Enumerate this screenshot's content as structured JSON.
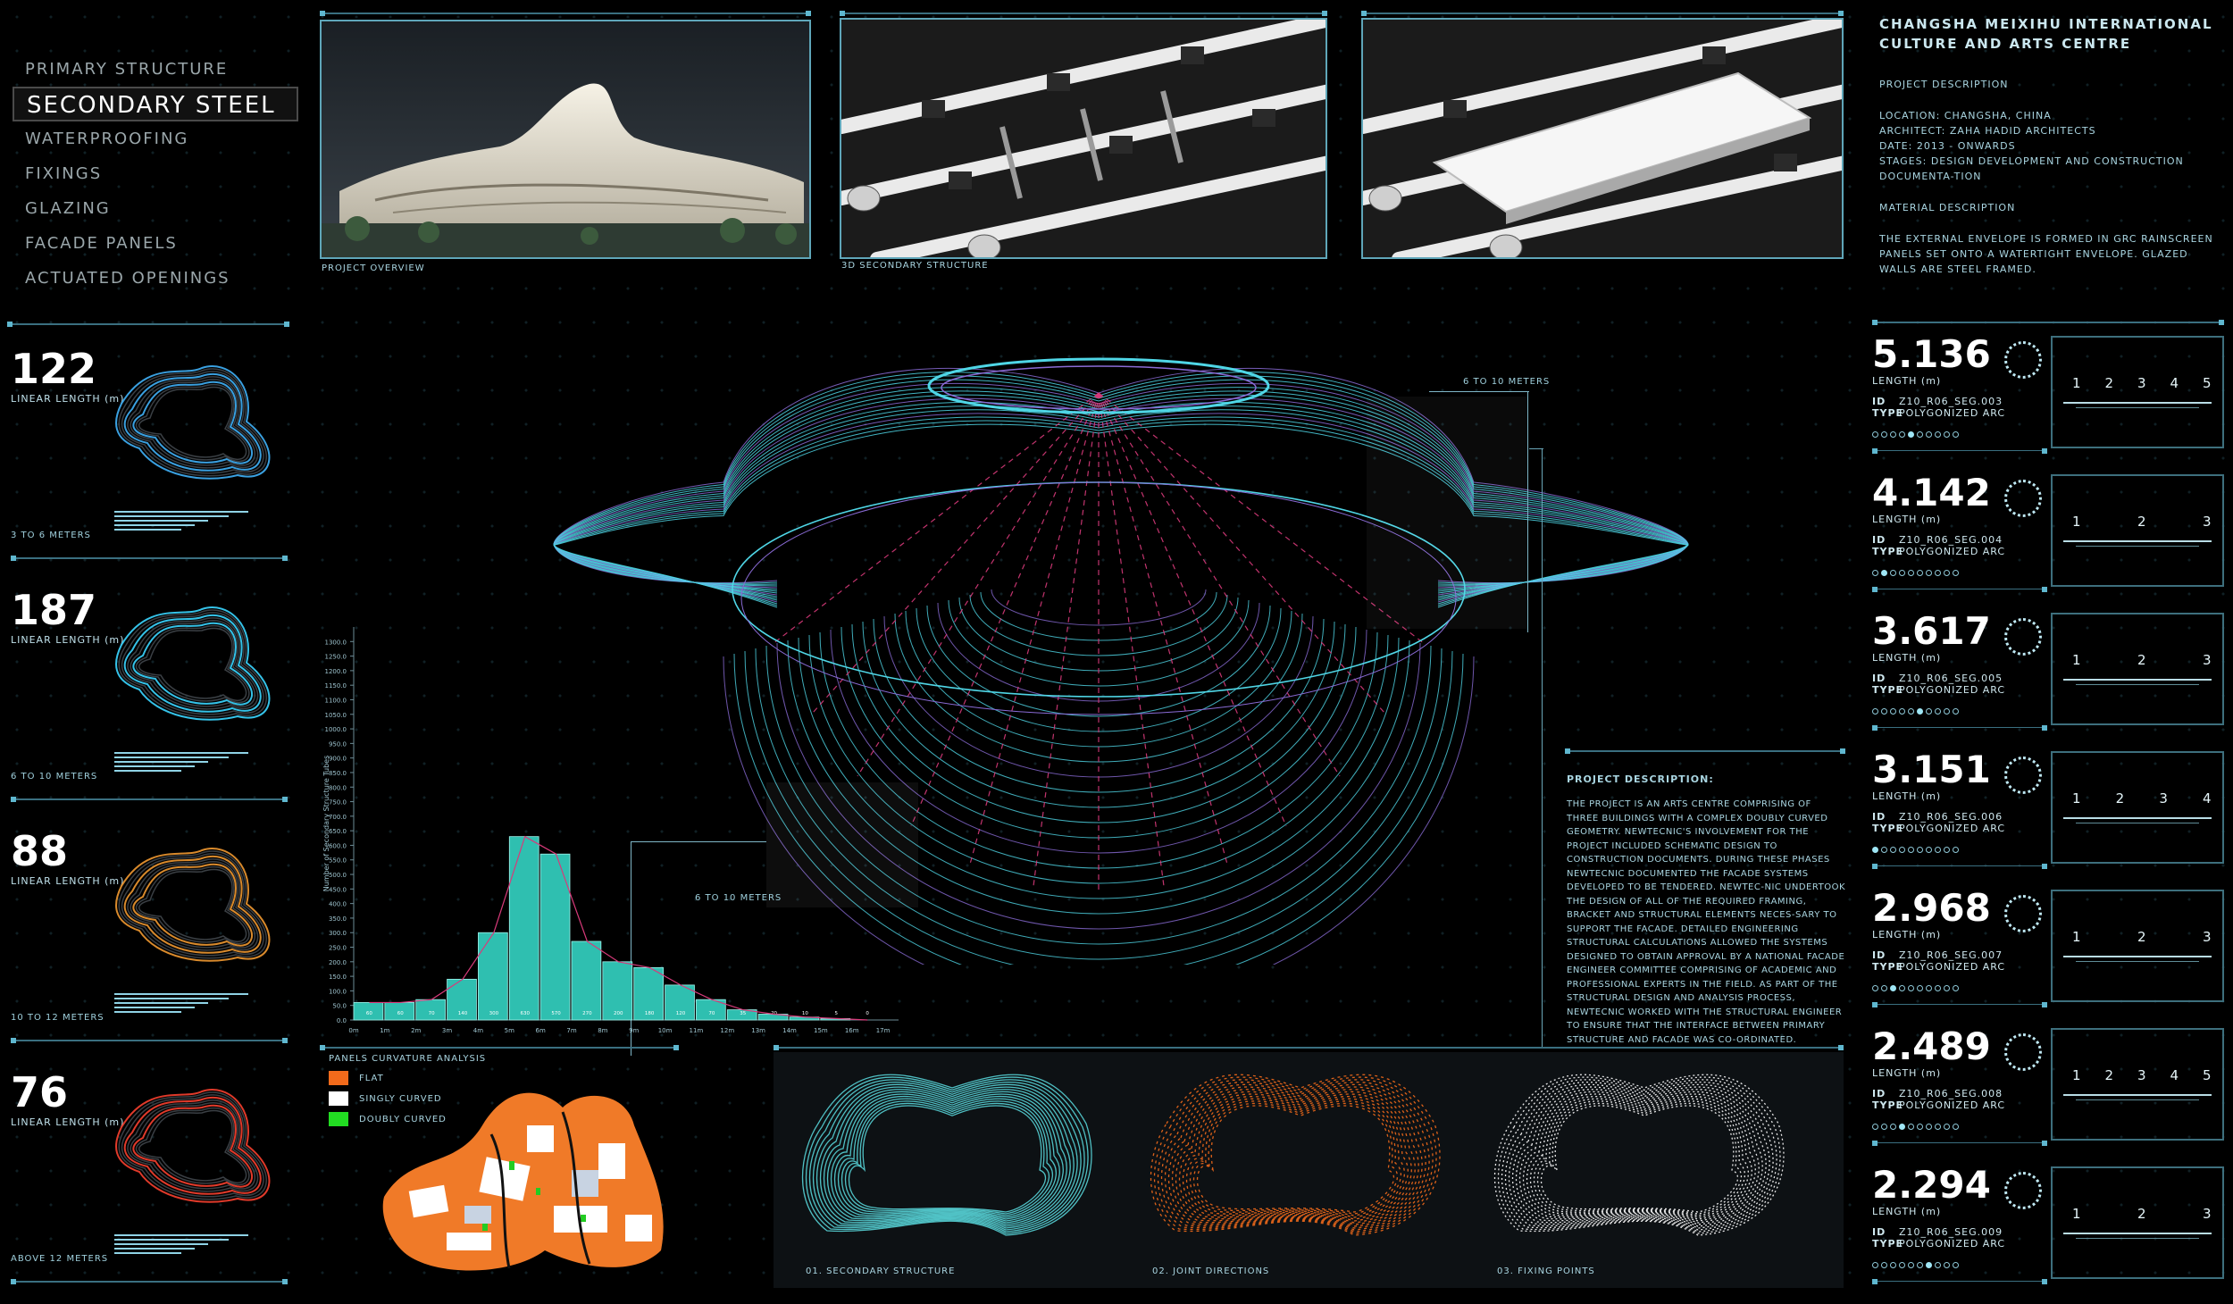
{
  "menu": {
    "items": [
      "PRIMARY STRUCTURE",
      "SECONDARY STEEL",
      "WATERPROOFING",
      "FIXINGS",
      "GLAZING",
      "FACADE PANELS",
      "ACTUATED OPENINGS"
    ],
    "active_index": 1
  },
  "stats": [
    {
      "value": "122",
      "label": "LINEAR LENGTH (m)",
      "range": "3 TO 6 METERS",
      "color": "#3aa0e0"
    },
    {
      "value": "187",
      "label": "LINEAR LENGTH (m)",
      "range": "6 TO 10 METERS",
      "color": "#35c2e8"
    },
    {
      "value": "88",
      "label": "LINEAR LENGTH (m)",
      "range": "10 TO 12 METERS",
      "color": "#d98a2c"
    },
    {
      "value": "76",
      "label": "LINEAR LENGTH (m)",
      "range": "ABOVE 12 METERS",
      "color": "#e03a2a"
    }
  ],
  "photos": {
    "overview_caption": "PROJECT OVERVIEW",
    "secondary_caption": "3D SECONDARY STRUCTURE"
  },
  "right_panel": {
    "title": "CHANGSHA MEIXIHU INTERNATIONAL CULTURE AND ARTS CENTRE",
    "project_desc_heading": "PROJECT DESCRIPTION",
    "location": "LOCATION: CHANGSHA, CHINA",
    "architect": "ARCHITECT: ZAHA HADID ARCHITECTS",
    "date": "DATE: 2013 - ONWARDS",
    "stages": "STAGES: DESIGN DEVELOPMENT AND CONSTRUCTION DOCUMENTA-TION",
    "material_heading": "MATERIAL DESCRIPTION",
    "material_text": "THE EXTERNAL ENVELOPE IS FORMED IN GRC RAINSCREEN PANELS SET ONTO A WATERTIGHT ENVELOPE. GLAZED WALLS ARE STEEL FRAMED."
  },
  "segments": [
    {
      "value": "5.136",
      "length_label": "LENGTH (m)",
      "id_label": "ID",
      "id": "Z10_R06_SEG.003",
      "type_label": "TYPE",
      "type": "POLYGONIZED ARC",
      "active_dot": 4,
      "scale": [
        "1",
        "2",
        "3",
        "4",
        "5"
      ]
    },
    {
      "value": "4.142",
      "length_label": "LENGTH (m)",
      "id_label": "ID",
      "id": "Z10_R06_SEG.004",
      "type_label": "TYPE",
      "type": "POLYGONIZED ARC",
      "active_dot": 1,
      "scale": [
        "1",
        "2",
        "3"
      ]
    },
    {
      "value": "3.617",
      "length_label": "LENGTH (m)",
      "id_label": "ID",
      "id": "Z10_R06_SEG.005",
      "type_label": "TYPE",
      "type": "POLYGONIZED ARC",
      "active_dot": 5,
      "scale": [
        "1",
        "2",
        "3"
      ]
    },
    {
      "value": "3.151",
      "length_label": "LENGTH (m)",
      "id_label": "ID",
      "id": "Z10_R06_SEG.006",
      "type_label": "TYPE",
      "type": "POLYGONIZED ARC",
      "active_dot": 0,
      "scale": [
        "1",
        "2",
        "3",
        "4"
      ]
    },
    {
      "value": "2.968",
      "length_label": "LENGTH (m)",
      "id_label": "ID",
      "id": "Z10_R06_SEG.007",
      "type_label": "TYPE",
      "type": "POLYGONIZED ARC",
      "active_dot": 2,
      "scale": [
        "1",
        "2",
        "3"
      ]
    },
    {
      "value": "2.489",
      "length_label": "LENGTH (m)",
      "id_label": "ID",
      "id": "Z10_R06_SEG.008",
      "type_label": "TYPE",
      "type": "POLYGONIZED ARC",
      "active_dot": 3,
      "scale": [
        "1",
        "2",
        "3",
        "4",
        "5"
      ]
    },
    {
      "value": "2.294",
      "length_label": "LENGTH (m)",
      "id_label": "ID",
      "id": "Z10_R06_SEG.009",
      "type_label": "TYPE",
      "type": "POLYGONIZED ARC",
      "active_dot": 6,
      "scale": [
        "1",
        "2",
        "3"
      ]
    }
  ],
  "center": {
    "callout_top": "6 TO 10 METERS",
    "callout_left": "6 TO 10 METERS",
    "description_heading": "PROJECT DESCRIPTION:",
    "description_text": "THE PROJECT IS AN ARTS CENTRE COMPRISING OF THREE BUILDINGS WITH A COMPLEX DOUBLY CURVED GEOMETRY. NEWTECNIC'S INVOLVEMENT FOR THE PROJECT INCLUDED SCHEMATIC DESIGN TO CONSTRUCTION DOCUMENTS. DURING THESE PHASES NEWTECNIC DOCUMENTED THE FACADE SYSTEMS DEVELOPED TO BE TENDERED. NEWTEC-NIC UNDERTOOK THE DESIGN OF ALL OF THE REQUIRED FRAMING, BRACKET AND STRUCTURAL ELEMENTS NECES-SARY TO SUPPORT THE FACADE. DETAILED ENGINEERING STRUCTURAL CALCULATIONS ALLOWED THE SYSTEMS DESIGNED TO OBTAIN APPROVAL BY A NATIONAL FACADE ENGINEER COMMITTEE COMPRISING OF ACADEMIC AND PROFESSIONAL EXPERTS IN THE FIELD. AS PART OF THE STRUCTURAL DESIGN AND ANALYSIS PROCESS, NEWTECNIC WORKED WITH THE STRUCTURAL ENGINEER TO ENSURE THAT THE INTERFACE BETWEEN PRIMARY STRUCTURE AND FACADE WAS CO-ORDINATED."
  },
  "curvature": {
    "title": "PANELS CURVATURE ANALYSIS",
    "legend": [
      {
        "label": "FLAT",
        "color": "#f26a1b"
      },
      {
        "label": "SINGLY CURVED",
        "color": "#ffffff"
      },
      {
        "label": "DOUBLY CURVED",
        "color": "#22dd22"
      }
    ]
  },
  "bottom_captions": [
    "01. SECONDARY STRUCTURE",
    "02. JOINT DIRECTIONS",
    "03. FIXING POINTS"
  ],
  "colors": {
    "accent": "#3fc9c0",
    "line": "#3a6f80",
    "pink": "#d83a7a"
  },
  "chart_data": {
    "type": "bar",
    "ylabel": "Number of Secondary Structure Tubes",
    "categories": [
      "0m",
      "1m",
      "2m",
      "3m",
      "4m",
      "5m",
      "6m",
      "7m",
      "8m",
      "9m",
      "10m",
      "11m",
      "12m",
      "13m",
      "14m",
      "15m",
      "16m",
      "17m"
    ],
    "values": [
      60,
      60,
      70,
      140,
      300,
      630,
      570,
      270,
      200,
      180,
      120,
      70,
      35,
      20,
      10,
      5,
      0
    ],
    "ylim": [
      0,
      1350
    ],
    "yticks": [
      "0.0",
      "50.0",
      "100.0",
      "150.0",
      "200.0",
      "250.0",
      "300.0",
      "350.0",
      "400.0",
      "450.0",
      "500.0",
      "550.0",
      "600.0",
      "650.0",
      "700.0",
      "750.0",
      "800.0",
      "850.0",
      "900.0",
      "950.0",
      "1000.0",
      "1050.0",
      "1100.0",
      "1150.0",
      "1200.0",
      "1250.0",
      "1300.0"
    ],
    "grid": true
  }
}
